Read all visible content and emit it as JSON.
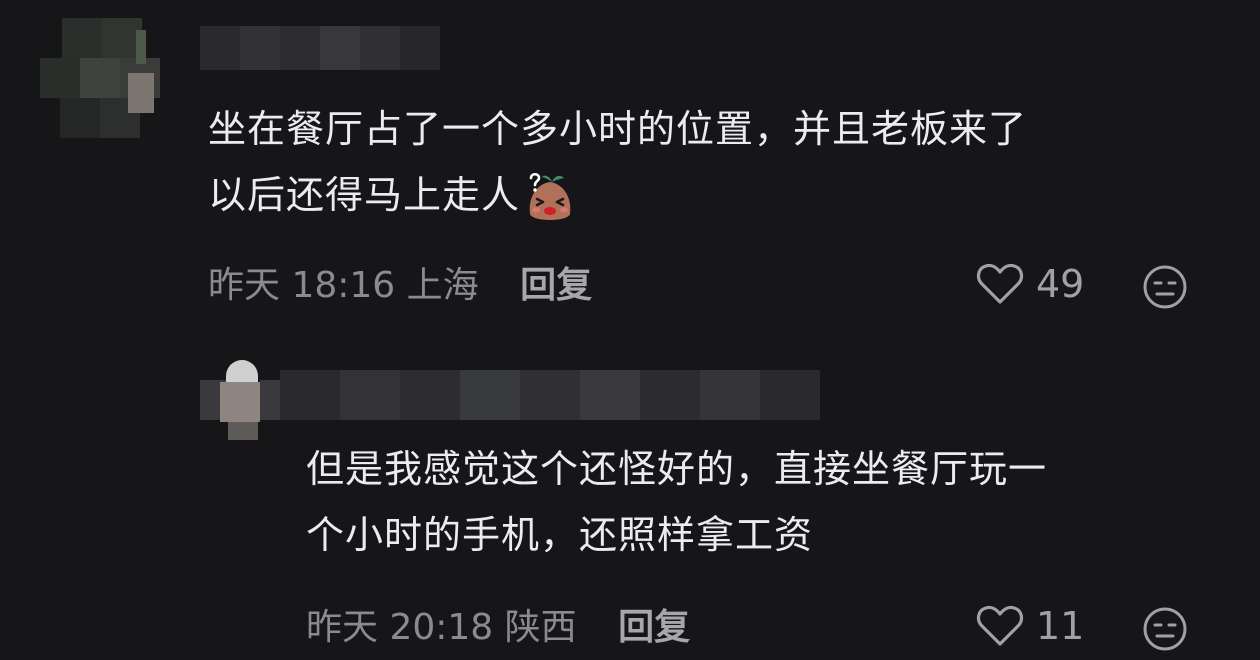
{
  "comments": [
    {
      "text_lines": [
        "坐在餐厅占了一个多小时的位置，并且老板来了",
        "以后还得马上走人"
      ],
      "emoji": "blushing-sweat-emoji",
      "time": "昨天 18:16",
      "location": "上海",
      "reply_label": "回复",
      "likes": "49"
    },
    {
      "text_lines": [
        "但是我感觉这个还怪好的，直接坐餐厅玩一",
        "个小时的手机，还照样拿工资"
      ],
      "time": "昨天 20:18",
      "location": "陕西",
      "reply_label": "回复",
      "likes": "11"
    }
  ],
  "icons": {
    "like": "heart-outline-icon",
    "dislike": "neutral-face-icon"
  },
  "colors": {
    "background": "#161619",
    "text": "#ececee",
    "meta": "#8a8a90"
  }
}
